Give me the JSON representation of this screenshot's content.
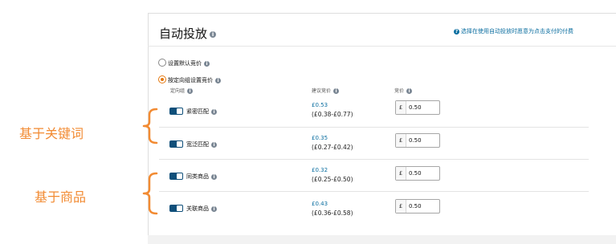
{
  "header": {
    "title": "自动投放",
    "help_link": "选择在使用自动投放时愿意为点击支付的付费"
  },
  "options": [
    {
      "label": "设置默认竞价",
      "selected": false
    },
    {
      "label": "按定向组设置竞价",
      "selected": true
    }
  ],
  "columns": {
    "group": "定向组",
    "suggested": "建议竞价",
    "bid": "竞价"
  },
  "currency": "£",
  "rows": [
    {
      "label": "紧密匹配",
      "enabled": true,
      "suggested": "£0.53",
      "range": "(£0.38-£0.77)",
      "bid": "0.50"
    },
    {
      "label": "宽泛匹配",
      "enabled": true,
      "suggested": "£0.35",
      "range": "(£0.27-£0.42)",
      "bid": "0.50"
    },
    {
      "label": "同类商品",
      "enabled": true,
      "suggested": "£0.32",
      "range": "(£0.25-£0.50)",
      "bid": "0.50"
    },
    {
      "label": "关联商品",
      "enabled": true,
      "suggested": "£0.43",
      "range": "(£0.36-£0.58)",
      "bid": "0.50"
    }
  ],
  "annotations": {
    "keyword": "基于关键词",
    "product": "基于商品",
    "color": "#f28b33"
  },
  "colors": {
    "accent": "#e47911",
    "toggle_on": "#0f4f7a",
    "link": "#0b6ea0"
  }
}
